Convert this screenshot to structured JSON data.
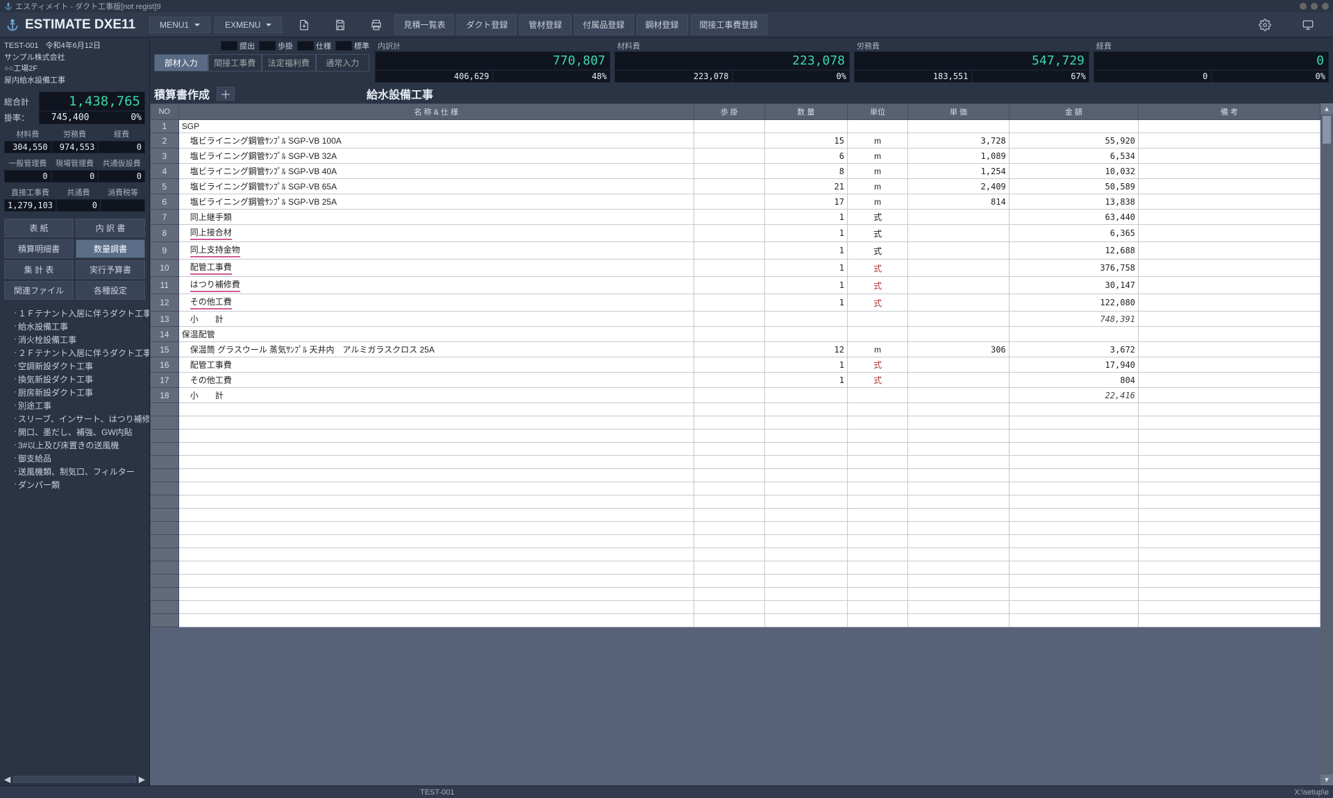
{
  "window": {
    "title": "エスティメイト - ダクト工事版[not regist]9"
  },
  "app": {
    "name": "ESTIMATE DXE11"
  },
  "menus": {
    "menu1": "MENU1",
    "exmenu": "EXMENU"
  },
  "nav": [
    "見積一覧表",
    "ダクト登録",
    "管材登録",
    "付属品登録",
    "鋼材登録",
    "間接工事費登録"
  ],
  "meta": {
    "id": "TEST-001",
    "date": "令和4年6月12日",
    "company": "サンプル株式会社",
    "site": "○○工場2F",
    "work": "屋内給水設備工事"
  },
  "summary": {
    "total_label": "総合計",
    "total": "1,438,765",
    "rate_label": "掛率：",
    "rate_val": "745,400",
    "rate_pct": "0%",
    "costs": [
      {
        "labels": [
          "材料費",
          "労務費",
          "経費"
        ],
        "vals": [
          "304,550",
          "974,553",
          "0"
        ]
      },
      {
        "labels": [
          "一般管理費",
          "現場管理費",
          "共通仮設費"
        ],
        "vals": [
          "0",
          "0",
          "0"
        ]
      },
      {
        "labels": [
          "直接工事費",
          "共通費",
          "消費税等"
        ],
        "vals": [
          "1,279,103",
          "0",
          ""
        ]
      }
    ]
  },
  "side_buttons": [
    "表 紙",
    "内 訳 書",
    "積算明細書",
    "数量調書",
    "集 計 表",
    "実行予算書",
    "関連ファイル",
    "各種設定"
  ],
  "side_selected_index": 3,
  "tree": [
    "１Ｆテナント入居に伴うダクト工事",
    "給水設備工事",
    "消火栓設備工事",
    "２Ｆテナント入居に伴うダクト工事",
    "空調新設ダクト工事",
    "換気新設ダクト工事",
    "厨房新設ダクト工事",
    "別途工事",
    "スリーブ、インサート、はつり補修",
    "開口、墨だし、補強、GW内貼",
    "3#以上及び床置きの送風機",
    "御支給品",
    "送風機類、制気口、フィルター",
    "ダンパー類"
  ],
  "tags": [
    "提出",
    "歩掛",
    "仕様",
    "標準"
  ],
  "tabs": [
    "部材入力",
    "間接工事費",
    "法定福利費",
    "通常入力"
  ],
  "kpis": [
    {
      "label": "内訳計",
      "big": "770,807",
      "sub": [
        "406,629",
        "48%"
      ]
    },
    {
      "label": "材料費",
      "big": "223,078",
      "sub": [
        "223,078",
        "0%"
      ]
    },
    {
      "label": "労務費",
      "big": "547,729",
      "sub": [
        "183,551",
        "67%"
      ]
    },
    {
      "label": "経費",
      "big": "0",
      "sub": [
        "0",
        "0%"
      ]
    }
  ],
  "sheet": {
    "title": "積算書作成",
    "section": "給水設備工事"
  },
  "columns": [
    "NO",
    "名 称 & 仕 様",
    "歩 掛",
    "数 量",
    "単位",
    "単 価",
    "金 額",
    "備 考"
  ],
  "rows": [
    {
      "no": 1,
      "name": "SGP",
      "group": true
    },
    {
      "no": 2,
      "name": "塩ビライニング鋼管ｻﾝﾌﾟﾙ SGP-VB 100A",
      "qty": "15",
      "unit": "m",
      "price": "3,728",
      "amt": "55,920"
    },
    {
      "no": 3,
      "name": "塩ビライニング鋼管ｻﾝﾌﾟﾙ SGP-VB 32A",
      "qty": "6",
      "unit": "m",
      "price": "1,089",
      "amt": "6,534"
    },
    {
      "no": 4,
      "name": "塩ビライニング鋼管ｻﾝﾌﾟﾙ SGP-VB 40A",
      "qty": "8",
      "unit": "m",
      "price": "1,254",
      "amt": "10,032"
    },
    {
      "no": 5,
      "name": "塩ビライニング鋼管ｻﾝﾌﾟﾙ SGP-VB 65A",
      "qty": "21",
      "unit": "m",
      "price": "2,409",
      "amt": "50,589"
    },
    {
      "no": 6,
      "name": "塩ビライニング鋼管ｻﾝﾌﾟﾙ SGP-VB 25A",
      "qty": "17",
      "unit": "m",
      "price": "814",
      "amt": "13,838"
    },
    {
      "no": 7,
      "name": "同上継手類",
      "qty": "1",
      "unit": "式",
      "amt": "63,440"
    },
    {
      "no": 8,
      "name": "同上接合材",
      "qty": "1",
      "unit": "式",
      "amt": "6,365",
      "pink": true
    },
    {
      "no": 9,
      "name": "同上支持金物",
      "qty": "1",
      "unit": "式",
      "amt": "12,688",
      "pink": true
    },
    {
      "no": 10,
      "name": "配管工事費",
      "qty": "1",
      "unit": "式",
      "unit_red": true,
      "amt": "376,758",
      "pink": true
    },
    {
      "no": 11,
      "name": "はつり補修費",
      "qty": "1",
      "unit": "式",
      "unit_red": true,
      "amt": "30,147",
      "pink": true
    },
    {
      "no": 12,
      "name": "その他工費",
      "qty": "1",
      "unit": "式",
      "unit_red": true,
      "amt": "122,080",
      "pink": true
    },
    {
      "no": 13,
      "name": "小　　計",
      "amt": "748,391",
      "subtotal": true
    },
    {
      "no": 14,
      "name": "保温配管",
      "group": true
    },
    {
      "no": 15,
      "name": "保温筒 グラスウール 蒸気ｻﾝﾌﾟﾙ 天井内　アルミガラスクロス 25A",
      "qty": "12",
      "unit": "m",
      "price": "306",
      "amt": "3,672"
    },
    {
      "no": 16,
      "name": "配管工事費",
      "qty": "1",
      "unit": "式",
      "unit_red": true,
      "amt": "17,940"
    },
    {
      "no": 17,
      "name": "その他工費",
      "qty": "1",
      "unit": "式",
      "unit_red": true,
      "amt": "804"
    },
    {
      "no": 18,
      "name": "小　　計",
      "amt": "22,416",
      "subtotal": true
    }
  ],
  "empty_rows": 17,
  "status": {
    "center": "TEST-001",
    "right": "X:\\setup\\e"
  }
}
